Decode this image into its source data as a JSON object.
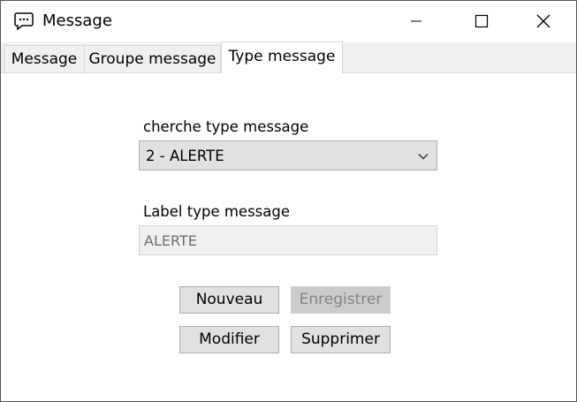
{
  "window": {
    "title": "Message",
    "icons": {
      "app": "speech-bubble-icon",
      "minimize": "minimize-icon",
      "maximize": "maximize-icon",
      "close": "close-icon"
    }
  },
  "tabs": [
    {
      "label": "Message",
      "active": false
    },
    {
      "label": "Groupe message",
      "active": false
    },
    {
      "label": "Type message",
      "active": true
    }
  ],
  "form": {
    "search_label": "cherche type message",
    "search_value": "2 - ALERTE",
    "label_label": "Label type message",
    "label_value": "ALERTE"
  },
  "buttons": {
    "new": "Nouveau",
    "save": "Enregistrer",
    "modify": "Modifier",
    "delete": "Supprimer"
  },
  "colors": {
    "button_bg": "#e1e1e1",
    "disabled_bg": "#cccccc",
    "disabled_text": "#838383"
  }
}
